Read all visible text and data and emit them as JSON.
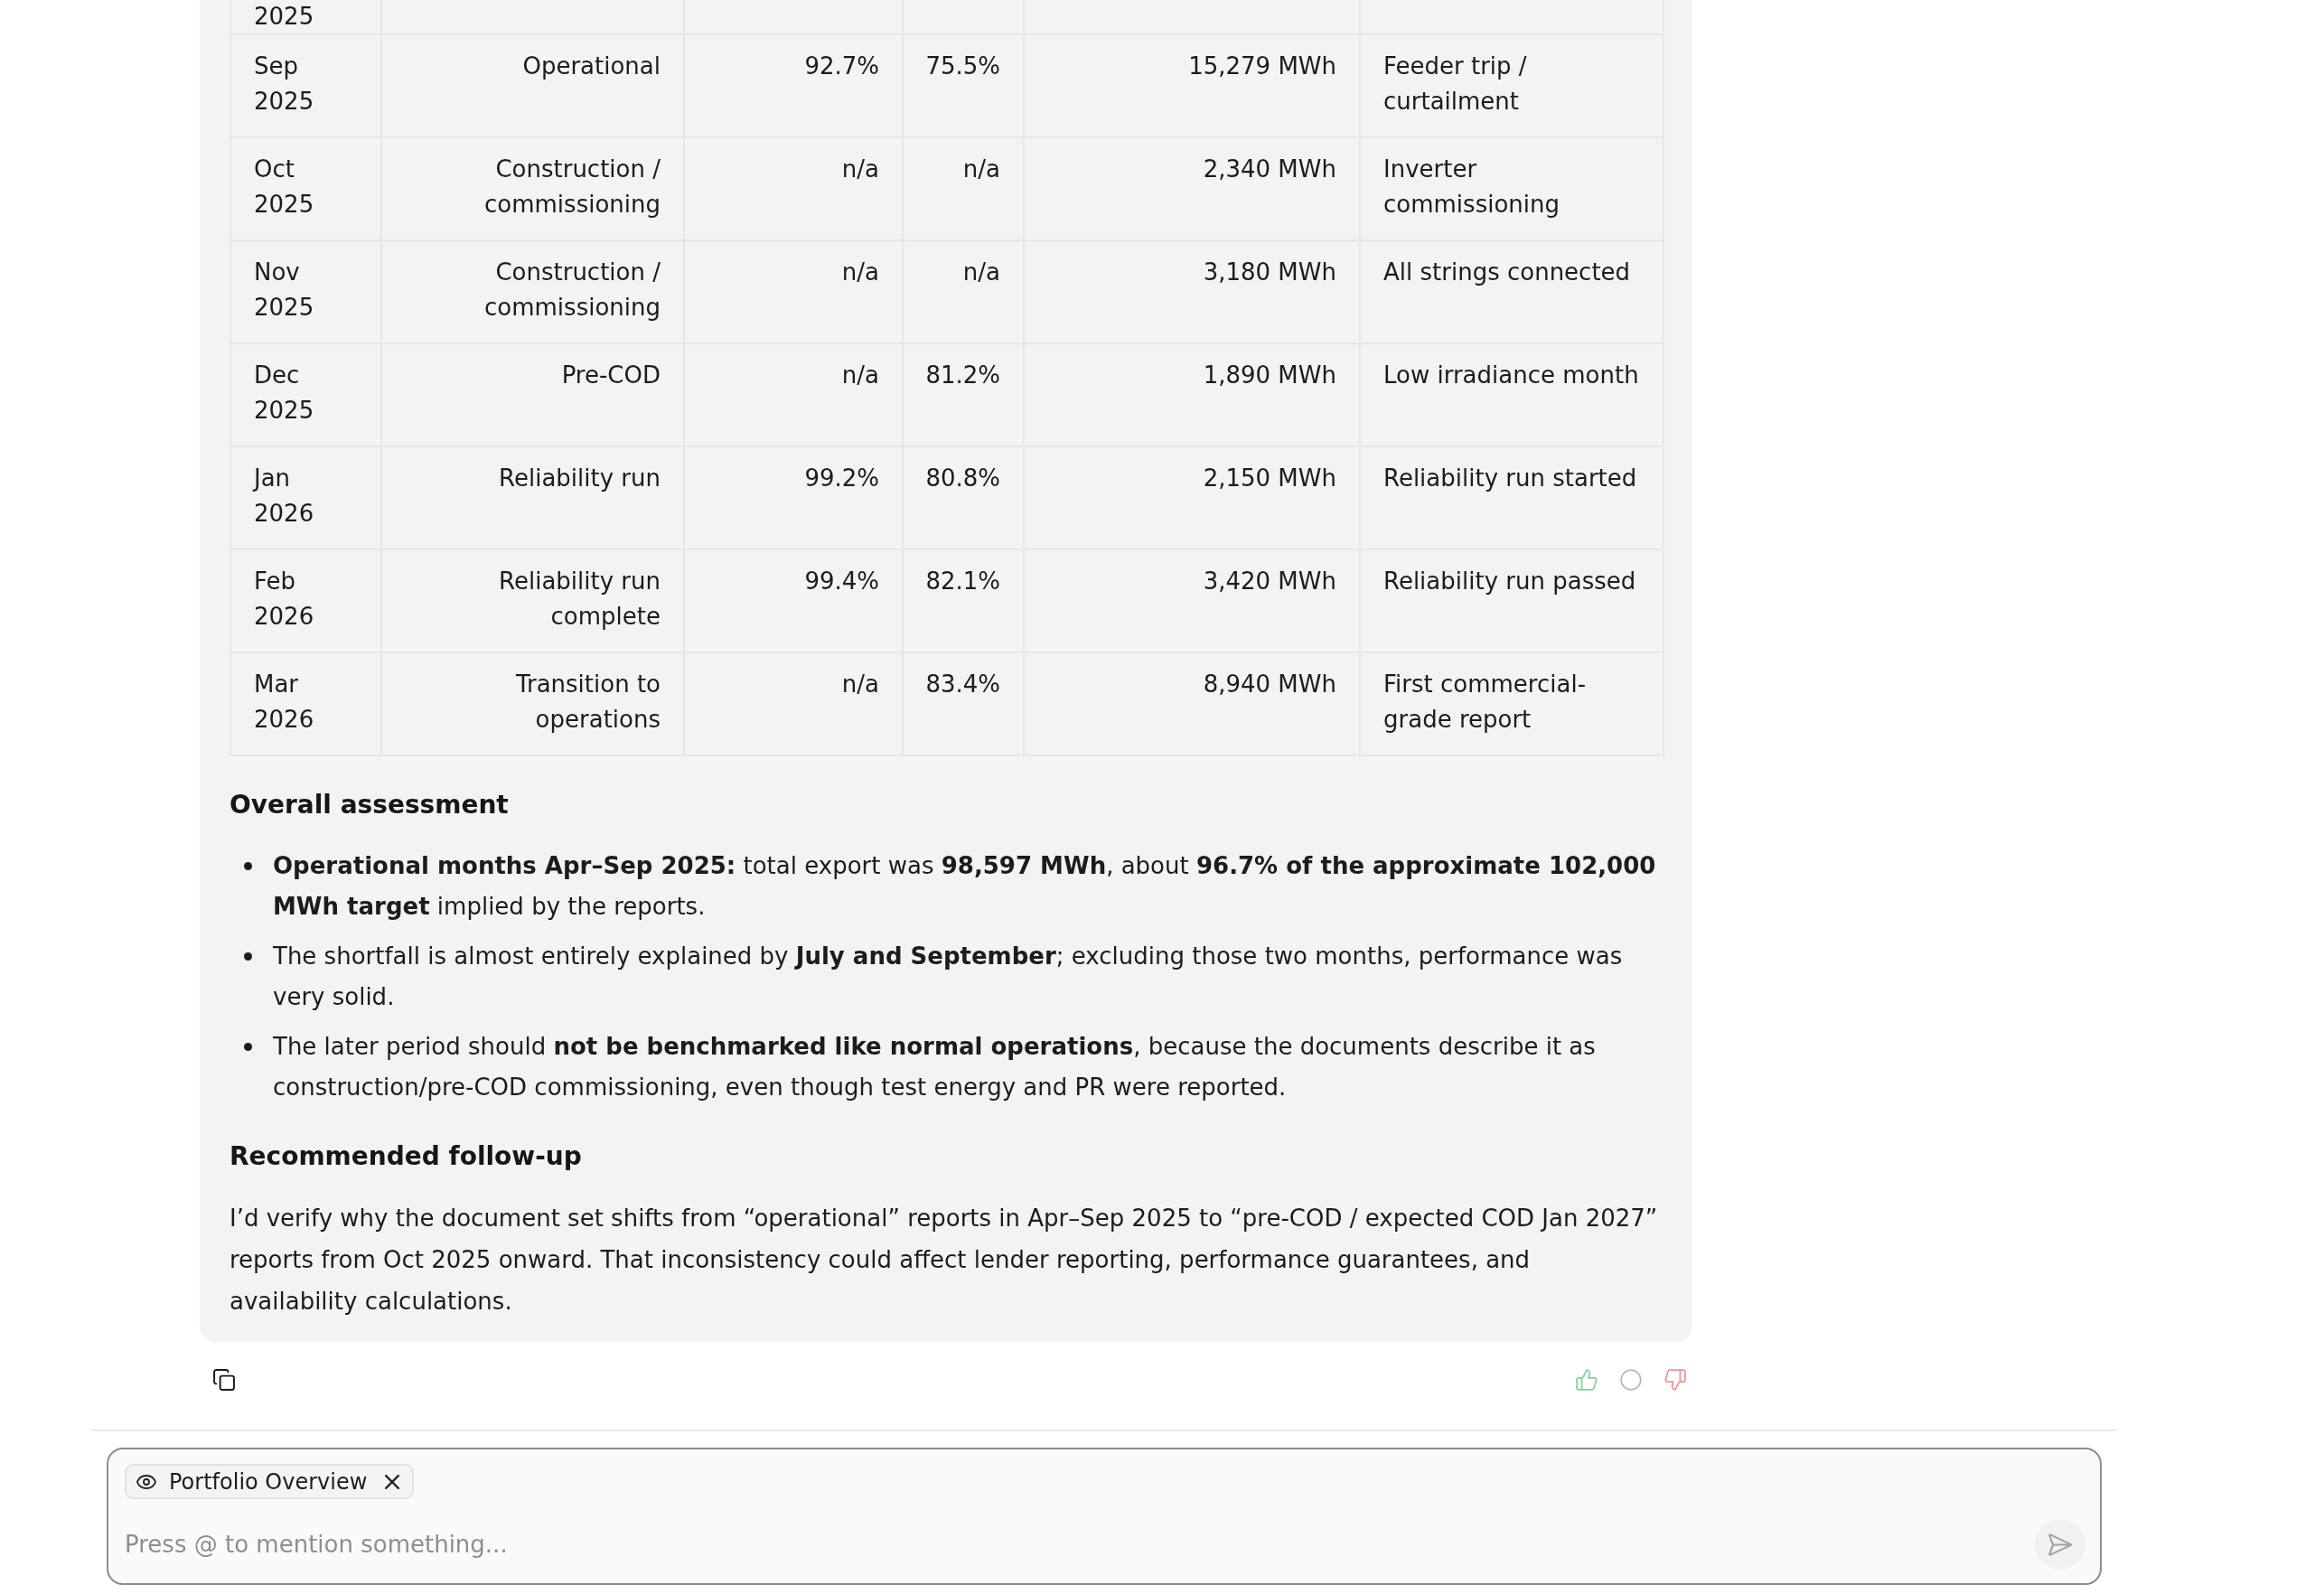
{
  "message": {
    "table": {
      "partly_hidden_row": [
        "2025"
      ],
      "rows": [
        [
          "Sep 2025",
          "Operational",
          "92.7%",
          "75.5%",
          "15,279 MWh",
          "Feeder trip / curtailment"
        ],
        [
          "Oct 2025",
          "Construction / commissioning",
          "n/a",
          "n/a",
          "2,340 MWh",
          "Inverter commissioning"
        ],
        [
          "Nov 2025",
          "Construction / commissioning",
          "n/a",
          "n/a",
          "3,180 MWh",
          "All strings connected"
        ],
        [
          "Dec 2025",
          "Pre-COD",
          "n/a",
          "81.2%",
          "1,890 MWh",
          "Low irradiance month"
        ],
        [
          "Jan 2026",
          "Reliability run",
          "99.2%",
          "80.8%",
          "2,150 MWh",
          "Reliability run started"
        ],
        [
          "Feb 2026",
          "Reliability run complete",
          "99.4%",
          "82.1%",
          "3,420 MWh",
          "Reliability run passed"
        ],
        [
          "Mar 2026",
          "Transition to operations",
          "n/a",
          "83.4%",
          "8,940 MWh",
          "First commercial-grade report"
        ]
      ]
    },
    "sections": [
      {
        "heading": "Overall assessment",
        "bullets": [
          "**Operational months Apr–Sep 2025:** total export was **98,597 MWh**, about **96.7% of the approximate 102,000 MWh target** implied by the reports.",
          "The shortfall is almost entirely explained by **July and September**; excluding those two months, performance was very solid.",
          "The later period should **not be benchmarked like normal operations**, because the documents describe it as construction/pre-COD commissioning, even though test energy and PR were reported."
        ]
      },
      {
        "heading": "Recommended follow-up",
        "paragraphs": [
          "I’d verify why the document set shifts from “operational” reports in Apr–Sep 2025 to “pre-COD / expected COD Jan 2027” reports from Oct 2025 onward. That inconsistency could affect lender reporting, performance guarantees, and availability calculations."
        ]
      }
    ]
  },
  "composer": {
    "context_chips": [
      {
        "label": "Portfolio Overview"
      }
    ],
    "placeholder": "Press @ to mention something..."
  }
}
